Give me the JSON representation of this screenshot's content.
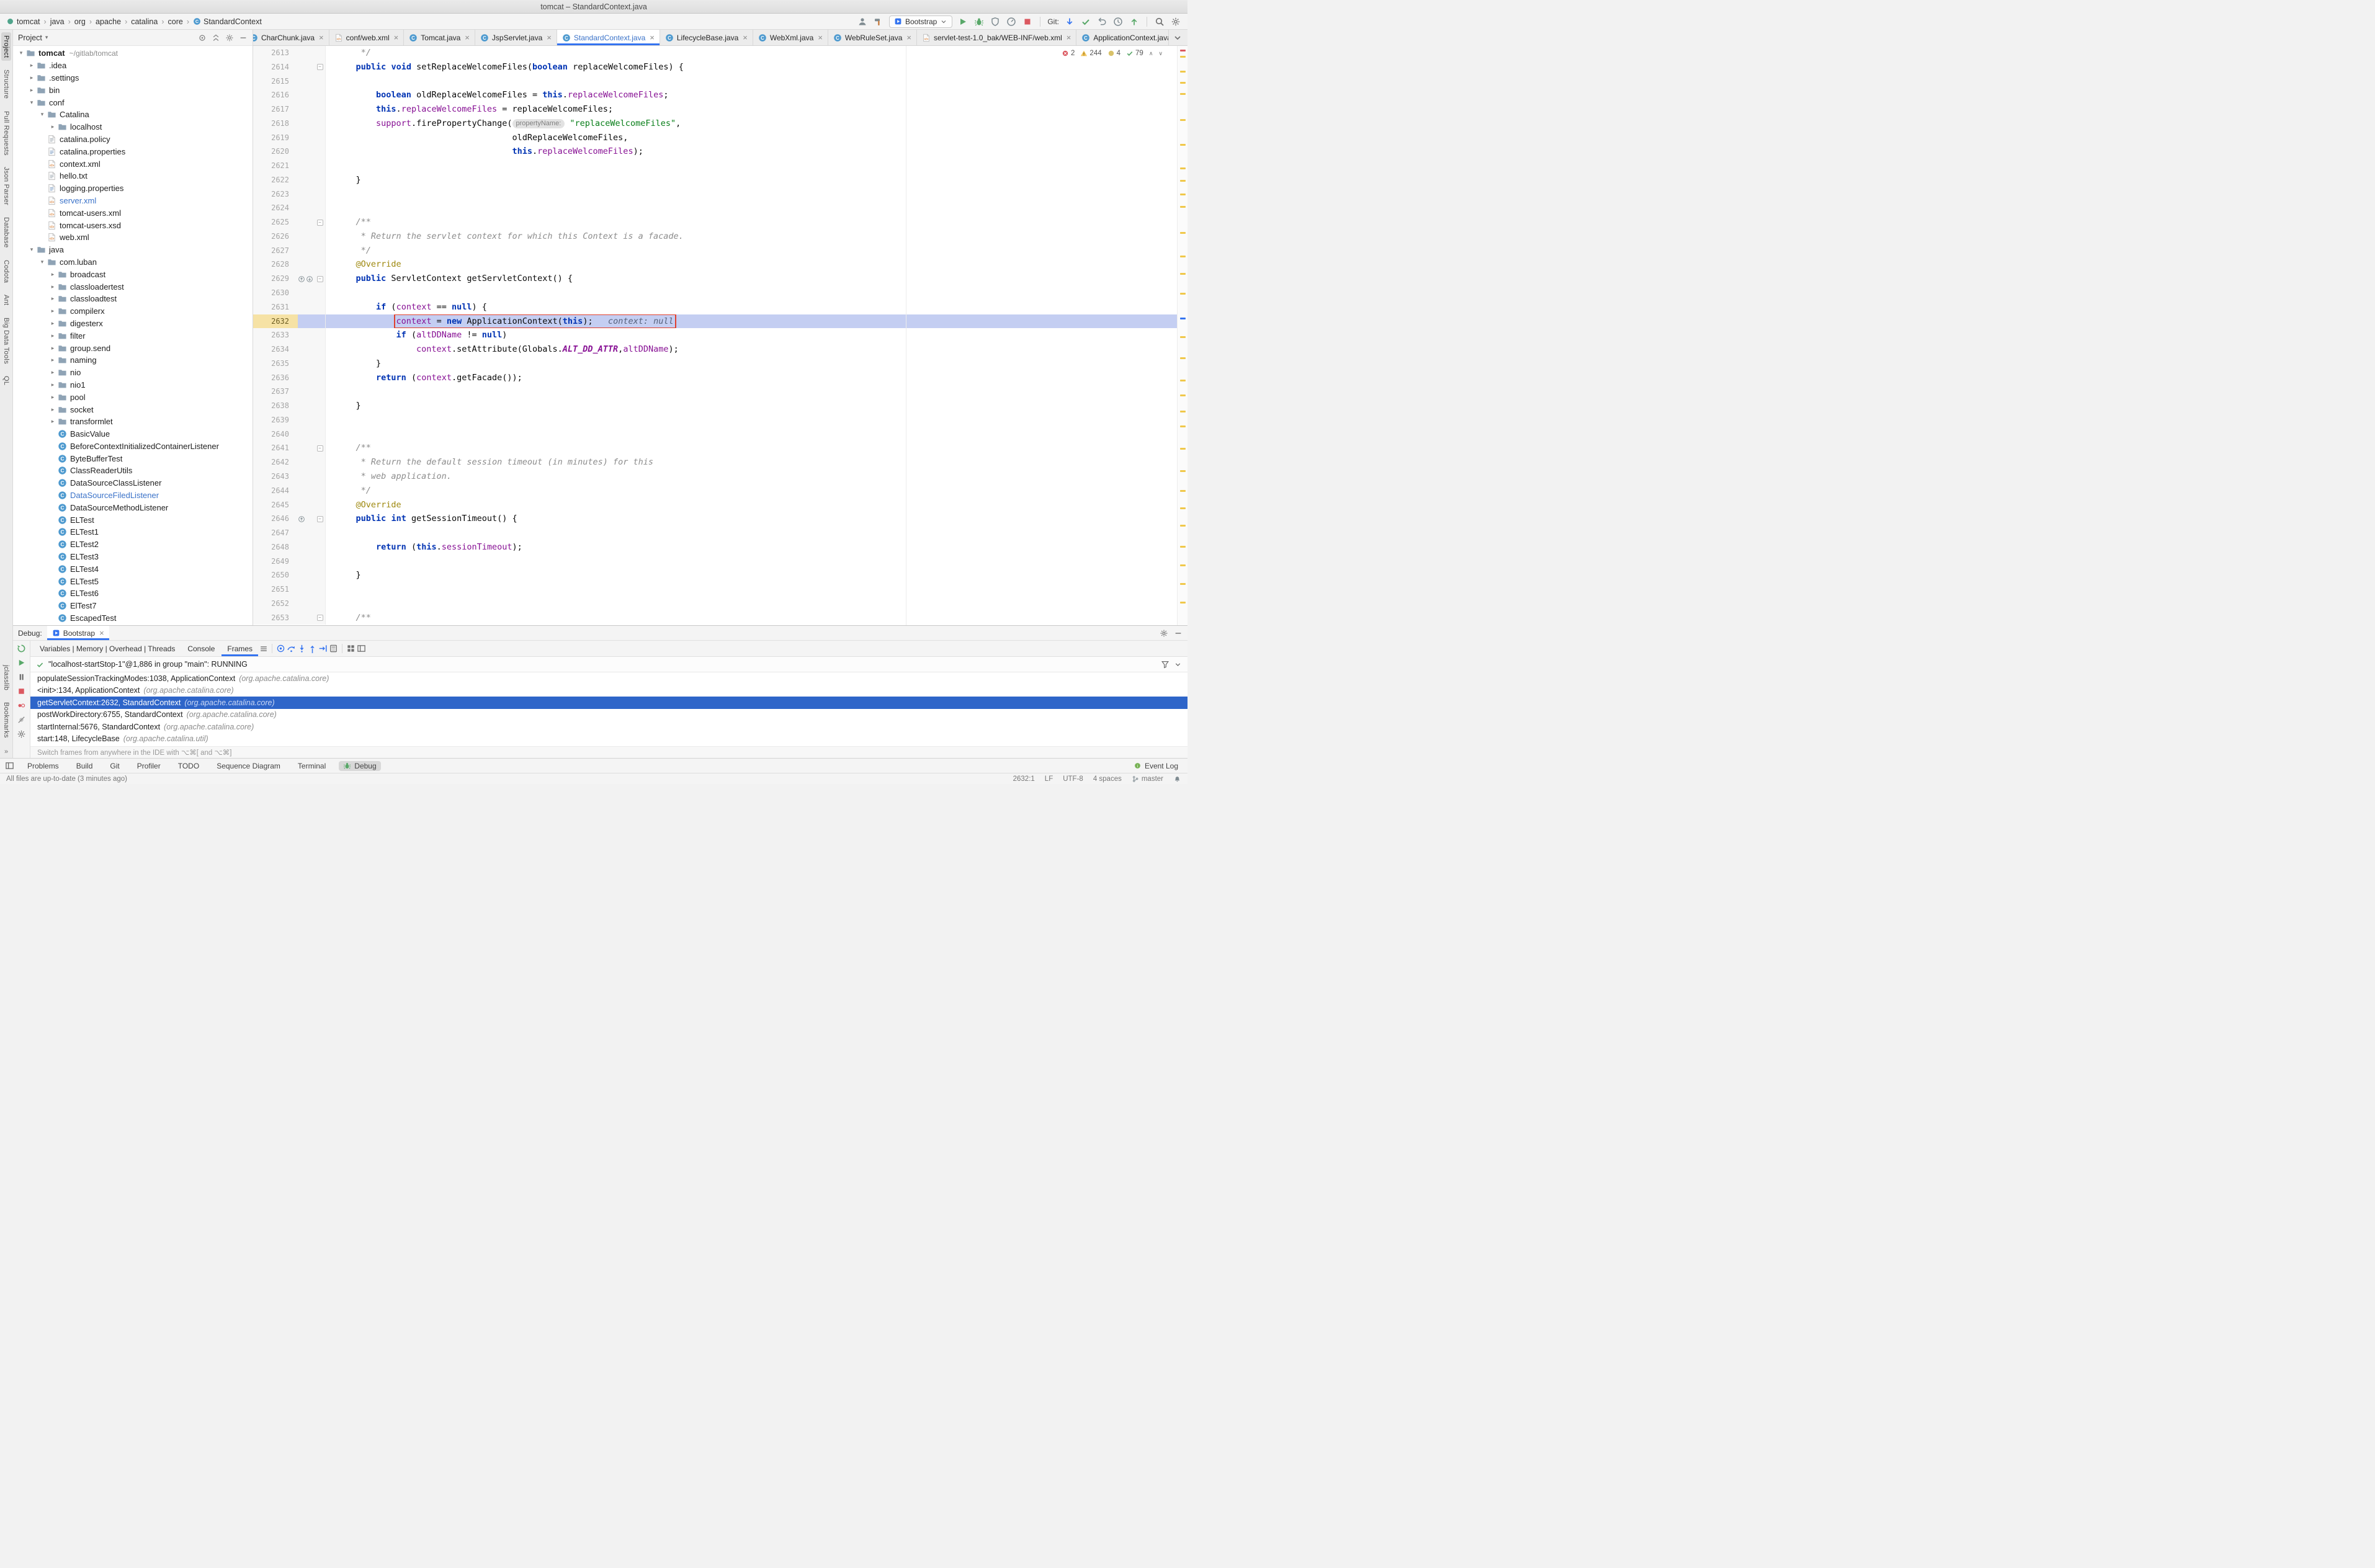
{
  "window_title": "tomcat – StandardContext.java",
  "breadcrumbs": {
    "items": [
      "tomcat",
      "java",
      "org",
      "apache",
      "catalina",
      "core",
      "StandardContext"
    ]
  },
  "toolbar": {
    "run_config": "Bootstrap",
    "git_label": "Git:"
  },
  "tool_strip": {
    "top": [
      "Project",
      "Structure",
      "Pull Requests",
      "Json Parser",
      "Database",
      "Codota",
      "Ant",
      "Big Data Tools",
      "QL"
    ],
    "bottom": [
      "jclasslib",
      "Bookmarks"
    ],
    "more": "»"
  },
  "project": {
    "header": "Project",
    "tree": [
      {
        "d": 0,
        "t": "folder",
        "c": "o",
        "l": "tomcat",
        "e": "~/gitlab/tomcat",
        "b": 1
      },
      {
        "d": 1,
        "t": "folder",
        "c": "c",
        "l": ".idea"
      },
      {
        "d": 1,
        "t": "folder",
        "c": "c",
        "l": ".settings"
      },
      {
        "d": 1,
        "t": "folder",
        "c": "c",
        "l": "bin"
      },
      {
        "d": 1,
        "t": "folder",
        "c": "o",
        "l": "conf"
      },
      {
        "d": 2,
        "t": "folder",
        "c": "o",
        "l": "Catalina"
      },
      {
        "d": 3,
        "t": "folder",
        "c": "c",
        "l": "localhost"
      },
      {
        "d": 2,
        "t": "file",
        "l": "catalina.policy"
      },
      {
        "d": 2,
        "t": "props",
        "l": "catalina.properties"
      },
      {
        "d": 2,
        "t": "xml",
        "l": "context.xml"
      },
      {
        "d": 2,
        "t": "file",
        "l": "hello.txt"
      },
      {
        "d": 2,
        "t": "props",
        "l": "logging.properties"
      },
      {
        "d": 2,
        "t": "xml",
        "l": "server.xml",
        "m": 1
      },
      {
        "d": 2,
        "t": "xml",
        "l": "tomcat-users.xml"
      },
      {
        "d": 2,
        "t": "xml",
        "l": "tomcat-users.xsd"
      },
      {
        "d": 2,
        "t": "xml",
        "l": "web.xml"
      },
      {
        "d": 1,
        "t": "folder",
        "c": "o",
        "l": "java"
      },
      {
        "d": 2,
        "t": "folder",
        "c": "o",
        "l": "com.luban"
      },
      {
        "d": 3,
        "t": "folder",
        "c": "c",
        "l": "broadcast"
      },
      {
        "d": 3,
        "t": "folder",
        "c": "c",
        "l": "classloadertest"
      },
      {
        "d": 3,
        "t": "folder",
        "c": "c",
        "l": "classloadtest"
      },
      {
        "d": 3,
        "t": "folder",
        "c": "c",
        "l": "compilerx"
      },
      {
        "d": 3,
        "t": "folder",
        "c": "c",
        "l": "digesterx"
      },
      {
        "d": 3,
        "t": "folder",
        "c": "c",
        "l": "filter"
      },
      {
        "d": 3,
        "t": "folder",
        "c": "c",
        "l": "group.send"
      },
      {
        "d": 3,
        "t": "folder",
        "c": "c",
        "l": "naming"
      },
      {
        "d": 3,
        "t": "folder",
        "c": "c",
        "l": "nio"
      },
      {
        "d": 3,
        "t": "folder",
        "c": "c",
        "l": "nio1"
      },
      {
        "d": 3,
        "t": "folder",
        "c": "c",
        "l": "pool"
      },
      {
        "d": 3,
        "t": "folder",
        "c": "c",
        "l": "socket"
      },
      {
        "d": 3,
        "t": "folder",
        "c": "c",
        "l": "transformlet"
      },
      {
        "d": 3,
        "t": "class",
        "l": "BasicValue"
      },
      {
        "d": 3,
        "t": "class",
        "l": "BeforeContextInitializedContainerListener"
      },
      {
        "d": 3,
        "t": "class",
        "l": "ByteBufferTest"
      },
      {
        "d": 3,
        "t": "class",
        "l": "ClassReaderUtils"
      },
      {
        "d": 3,
        "t": "class",
        "l": "DataSourceClassListener"
      },
      {
        "d": 3,
        "t": "class",
        "l": "DataSourceFiledListener",
        "m": 1
      },
      {
        "d": 3,
        "t": "class",
        "l": "DataSourceMethodListener"
      },
      {
        "d": 3,
        "t": "class",
        "l": "ELTest"
      },
      {
        "d": 3,
        "t": "class",
        "l": "ELTest1"
      },
      {
        "d": 3,
        "t": "class",
        "l": "ELTest2"
      },
      {
        "d": 3,
        "t": "class",
        "l": "ELTest3"
      },
      {
        "d": 3,
        "t": "class",
        "l": "ELTest4"
      },
      {
        "d": 3,
        "t": "class",
        "l": "ELTest5"
      },
      {
        "d": 3,
        "t": "class",
        "l": "ELTest6"
      },
      {
        "d": 3,
        "t": "class",
        "l": "ElTest7"
      },
      {
        "d": 3,
        "t": "class",
        "l": "EscapedTest"
      }
    ]
  },
  "tabs": [
    {
      "label": "CharChunk.java",
      "icon": "class"
    },
    {
      "label": "conf/web.xml",
      "icon": "xml"
    },
    {
      "label": "Tomcat.java",
      "icon": "class"
    },
    {
      "label": "JspServlet.java",
      "icon": "class"
    },
    {
      "label": "StandardContext.java",
      "icon": "class",
      "active": 1,
      "mod": 1
    },
    {
      "label": "LifecycleBase.java",
      "icon": "class"
    },
    {
      "label": "WebXml.java",
      "icon": "class"
    },
    {
      "label": "WebRuleSet.java",
      "icon": "class"
    },
    {
      "label": "servlet-test-1.0_bak/WEB-INF/web.xml",
      "icon": "xml"
    },
    {
      "label": "ApplicationContext.java",
      "icon": "class"
    }
  ],
  "editor": {
    "badges": {
      "errors": "2",
      "warnings": "244",
      "weak": "4",
      "ok": "79"
    },
    "lines": [
      {
        "n": 2613,
        "seg": [
          [
            "c",
            "     */"
          ]
        ]
      },
      {
        "n": 2614,
        "f": 1,
        "seg": [
          [
            "p",
            "    "
          ],
          [
            "k",
            "public"
          ],
          [
            "p",
            " "
          ],
          [
            "k",
            "void"
          ],
          [
            "p",
            " setReplaceWelcomeFiles("
          ],
          [
            "k",
            "boolean"
          ],
          [
            "p",
            " replaceWelcomeFiles) {"
          ]
        ]
      },
      {
        "n": 2615,
        "seg": []
      },
      {
        "n": 2616,
        "seg": [
          [
            "p",
            "        "
          ],
          [
            "k",
            "boolean"
          ],
          [
            "p",
            " oldReplaceWelcomeFiles = "
          ],
          [
            "k",
            "this"
          ],
          [
            "p",
            "."
          ],
          [
            "v",
            "replaceWelcomeFiles"
          ],
          [
            "p",
            ";"
          ]
        ]
      },
      {
        "n": 2617,
        "seg": [
          [
            "p",
            "        "
          ],
          [
            "k",
            "this"
          ],
          [
            "p",
            "."
          ],
          [
            "v",
            "replaceWelcomeFiles"
          ],
          [
            "p",
            " = replaceWelcomeFiles;"
          ]
        ]
      },
      {
        "n": 2618,
        "seg": [
          [
            "p",
            "        "
          ],
          [
            "v",
            "support"
          ],
          [
            "p",
            ".firePropertyChange("
          ],
          [
            "h",
            "propertyName:"
          ],
          [
            "p",
            " "
          ],
          [
            "str",
            "\"replaceWelcomeFiles\""
          ],
          [
            "p",
            ","
          ]
        ]
      },
      {
        "n": 2619,
        "seg": [
          [
            "p",
            "                                   oldReplaceWelcomeFiles,"
          ]
        ]
      },
      {
        "n": 2620,
        "seg": [
          [
            "p",
            "                                   "
          ],
          [
            "k",
            "this"
          ],
          [
            "p",
            "."
          ],
          [
            "v",
            "replaceWelcomeFiles"
          ],
          [
            "p",
            ");"
          ]
        ]
      },
      {
        "n": 2621,
        "seg": []
      },
      {
        "n": 2622,
        "seg": [
          [
            "p",
            "    }"
          ]
        ]
      },
      {
        "n": 2623,
        "seg": []
      },
      {
        "n": 2624,
        "seg": []
      },
      {
        "n": 2625,
        "f": 1,
        "seg": [
          [
            "c",
            "    /**"
          ]
        ]
      },
      {
        "n": 2626,
        "seg": [
          [
            "c",
            "     * Return the servlet context for which this Context is a facade."
          ]
        ]
      },
      {
        "n": 2627,
        "seg": [
          [
            "c",
            "     */"
          ]
        ]
      },
      {
        "n": 2628,
        "seg": [
          [
            "p",
            "    "
          ],
          [
            "a",
            "@Override"
          ]
        ]
      },
      {
        "n": 2629,
        "f": 1,
        "g": [
          "up",
          "down"
        ],
        "seg": [
          [
            "p",
            "    "
          ],
          [
            "k",
            "public"
          ],
          [
            "p",
            " ServletContext getServletContext() {"
          ]
        ]
      },
      {
        "n": 2630,
        "seg": []
      },
      {
        "n": 2631,
        "seg": [
          [
            "p",
            "        "
          ],
          [
            "k",
            "if"
          ],
          [
            "p",
            " ("
          ],
          [
            "v",
            "context"
          ],
          [
            "p",
            " == "
          ],
          [
            "k",
            "null"
          ],
          [
            "p",
            ") {"
          ]
        ]
      },
      {
        "n": 2632,
        "x": 1,
        "b": 1,
        "seg": [
          [
            "p",
            "            "
          ],
          [
            "v",
            "context"
          ],
          [
            "p",
            " = "
          ],
          [
            "k",
            "new"
          ],
          [
            "p",
            " ApplicationContext("
          ],
          [
            "k",
            "this"
          ],
          [
            "p",
            ");"
          ],
          [
            "d",
            "   context: null"
          ]
        ]
      },
      {
        "n": 2633,
        "seg": [
          [
            "p",
            "            "
          ],
          [
            "k",
            "if"
          ],
          [
            "p",
            " ("
          ],
          [
            "v",
            "altDDName"
          ],
          [
            "p",
            " != "
          ],
          [
            "k",
            "null"
          ],
          [
            "p",
            ")"
          ]
        ]
      },
      {
        "n": 2634,
        "seg": [
          [
            "p",
            "                "
          ],
          [
            "v",
            "context"
          ],
          [
            "p",
            ".setAttribute(Globals."
          ],
          [
            "sf",
            "ALT_DD_ATTR"
          ],
          [
            "p",
            ","
          ],
          [
            "v",
            "altDDName"
          ],
          [
            "p",
            ");"
          ]
        ]
      },
      {
        "n": 2635,
        "seg": [
          [
            "p",
            "        }"
          ]
        ]
      },
      {
        "n": 2636,
        "seg": [
          [
            "p",
            "        "
          ],
          [
            "k",
            "return"
          ],
          [
            "p",
            " ("
          ],
          [
            "v",
            "context"
          ],
          [
            "p",
            ".getFacade());"
          ]
        ]
      },
      {
        "n": 2637,
        "seg": []
      },
      {
        "n": 2638,
        "seg": [
          [
            "p",
            "    }"
          ]
        ]
      },
      {
        "n": 2639,
        "seg": []
      },
      {
        "n": 2640,
        "seg": []
      },
      {
        "n": 2641,
        "f": 1,
        "seg": [
          [
            "c",
            "    /**"
          ]
        ]
      },
      {
        "n": 2642,
        "seg": [
          [
            "c",
            "     * Return the default session timeout (in minutes) for this"
          ]
        ]
      },
      {
        "n": 2643,
        "seg": [
          [
            "c",
            "     * web application."
          ]
        ]
      },
      {
        "n": 2644,
        "seg": [
          [
            "c",
            "     */"
          ]
        ]
      },
      {
        "n": 2645,
        "seg": [
          [
            "p",
            "    "
          ],
          [
            "a",
            "@Override"
          ]
        ]
      },
      {
        "n": 2646,
        "f": 1,
        "g": [
          "up"
        ],
        "seg": [
          [
            "p",
            "    "
          ],
          [
            "k",
            "public"
          ],
          [
            "p",
            " "
          ],
          [
            "k",
            "int"
          ],
          [
            "p",
            " getSessionTimeout() {"
          ]
        ]
      },
      {
        "n": 2647,
        "seg": []
      },
      {
        "n": 2648,
        "seg": [
          [
            "p",
            "        "
          ],
          [
            "k",
            "return"
          ],
          [
            "p",
            " ("
          ],
          [
            "k",
            "this"
          ],
          [
            "p",
            "."
          ],
          [
            "v",
            "sessionTimeout"
          ],
          [
            "p",
            ");"
          ]
        ]
      },
      {
        "n": 2649,
        "seg": []
      },
      {
        "n": 2650,
        "seg": [
          [
            "p",
            "    }"
          ]
        ]
      },
      {
        "n": 2651,
        "seg": []
      },
      {
        "n": 2652,
        "seg": []
      },
      {
        "n": 2653,
        "f": 1,
        "seg": [
          [
            "c",
            "    /**"
          ]
        ]
      }
    ]
  },
  "debug": {
    "label": "Debug:",
    "session_tab": "Bootstrap",
    "tabs": [
      {
        "label": "Variables | Memory | Overhead | Threads"
      },
      {
        "label": "Console"
      },
      {
        "label": "Frames",
        "active": 1
      }
    ],
    "thread": "\"localhost-startStop-1\"@1,886 in group \"main\": RUNNING",
    "frames": [
      {
        "text": "populateSessionTrackingModes:1038, ApplicationContext",
        "pkg": "(org.apache.catalina.core)"
      },
      {
        "text": "<init>:134, ApplicationContext",
        "pkg": "(org.apache.catalina.core)"
      },
      {
        "text": "getServletContext:2632, StandardContext",
        "pkg": "(org.apache.catalina.core)",
        "selected": 1
      },
      {
        "text": "postWorkDirectory:6755, StandardContext",
        "pkg": "(org.apache.catalina.core)"
      },
      {
        "text": "startInternal:5676, StandardContext",
        "pkg": "(org.apache.catalina.core)"
      },
      {
        "text": "start:148, LifecycleBase",
        "pkg": "(org.apache.catalina.util)"
      }
    ],
    "hint": "Switch frames from anywhere in the IDE with ⌥⌘[ and ⌥⌘]"
  },
  "bottom_bar": {
    "left": [
      "Problems",
      "Build",
      "Git",
      "Profiler",
      "TODO",
      "Sequence Diagram",
      "Terminal",
      "Debug"
    ],
    "active": "Debug",
    "right": "Event Log"
  },
  "status_bar": {
    "message": "All files are up-to-date (3 minutes ago)",
    "caret": "2632:1",
    "line_sep": "LF",
    "encoding": "UTF-8",
    "indent": "4 spaces",
    "branch": "master"
  },
  "colors": {
    "accent": "#3574F0",
    "execution_line": "#C4CEF2",
    "execution_box": "#E0402E",
    "error": "#DB5860",
    "warning": "#F2C55C",
    "ok": "#59A869",
    "modified_file": "#3B73C9",
    "keyword": "#0033B3",
    "string": "#067D17",
    "field": "#871094",
    "comment": "#8C8C8C"
  }
}
